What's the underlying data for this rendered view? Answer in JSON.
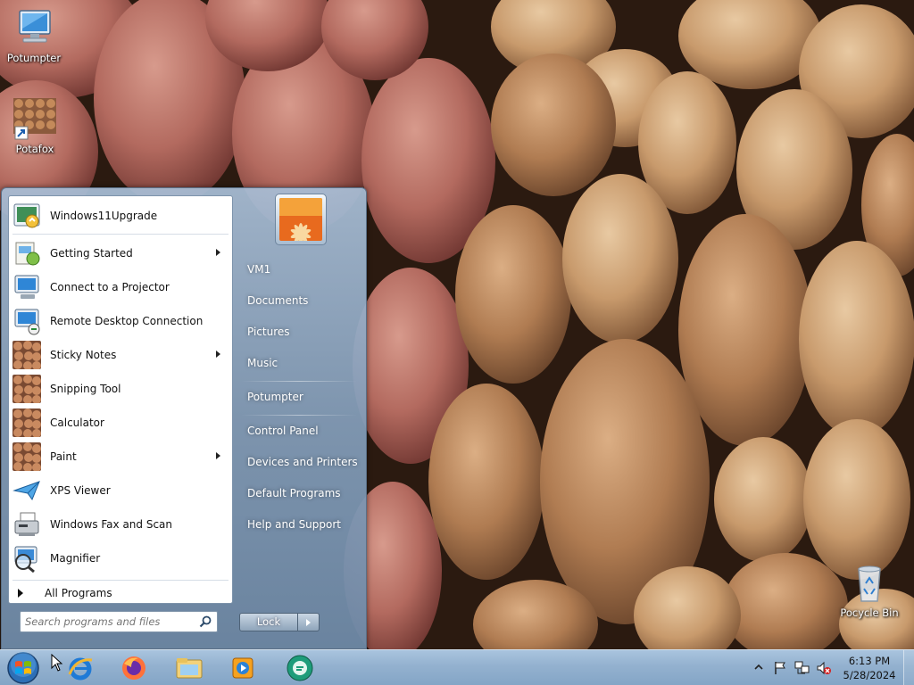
{
  "desktop": {
    "icons": [
      {
        "label": "Potumpter",
        "icon": "computer-icon"
      },
      {
        "label": "Potafox",
        "icon": "potato-shortcut-icon"
      },
      {
        "label": "Pocycle Bin",
        "icon": "recycle-bin-icon"
      }
    ],
    "wallpaper": "potatoes"
  },
  "start_menu": {
    "pinned": {
      "label": "Windows11Upgrade",
      "icon": "upgrade-icon"
    },
    "programs": [
      {
        "label": "Getting Started",
        "icon": "getting-started-icon",
        "submenu": true
      },
      {
        "label": "Connect to a Projector",
        "icon": "projector-icon",
        "submenu": false
      },
      {
        "label": "Remote Desktop Connection",
        "icon": "remote-desktop-icon",
        "submenu": false
      },
      {
        "label": "Sticky Notes",
        "icon": "potato-icon",
        "submenu": true
      },
      {
        "label": "Snipping Tool",
        "icon": "potato-icon",
        "submenu": false
      },
      {
        "label": "Calculator",
        "icon": "potato-icon",
        "submenu": false
      },
      {
        "label": "Paint",
        "icon": "potato-icon",
        "submenu": true
      },
      {
        "label": "XPS Viewer",
        "icon": "xps-viewer-icon",
        "submenu": false
      },
      {
        "label": "Windows Fax and Scan",
        "icon": "fax-icon",
        "submenu": false
      },
      {
        "label": "Magnifier",
        "icon": "magnifier-icon",
        "submenu": false
      }
    ],
    "all_programs": "All Programs",
    "search": {
      "placeholder": "Search programs and files"
    },
    "right_items": [
      {
        "label": "VM1"
      },
      {
        "label": "Documents"
      },
      {
        "label": "Pictures"
      },
      {
        "label": "Music"
      },
      {
        "label": "Potumpter"
      },
      {
        "label": "Control Panel"
      },
      {
        "label": "Devices and Printers"
      },
      {
        "label": "Default Programs"
      },
      {
        "label": "Help and Support"
      }
    ],
    "lock_label": "Lock"
  },
  "taskbar": {
    "pinned": [
      "internet-explorer-icon",
      "firefox-icon",
      "file-explorer-icon",
      "media-player-icon",
      "chat-icon"
    ],
    "tray": [
      "show-hidden-icons",
      "action-center-flag-icon",
      "network-icon",
      "volume-muted-icon"
    ],
    "clock": {
      "time": "6:13 PM",
      "date": "5/28/2024"
    }
  },
  "colors": {
    "taskbar": "#93b1cf",
    "start_menu_pane": "#ffffff",
    "accent": "#2a6db5"
  }
}
